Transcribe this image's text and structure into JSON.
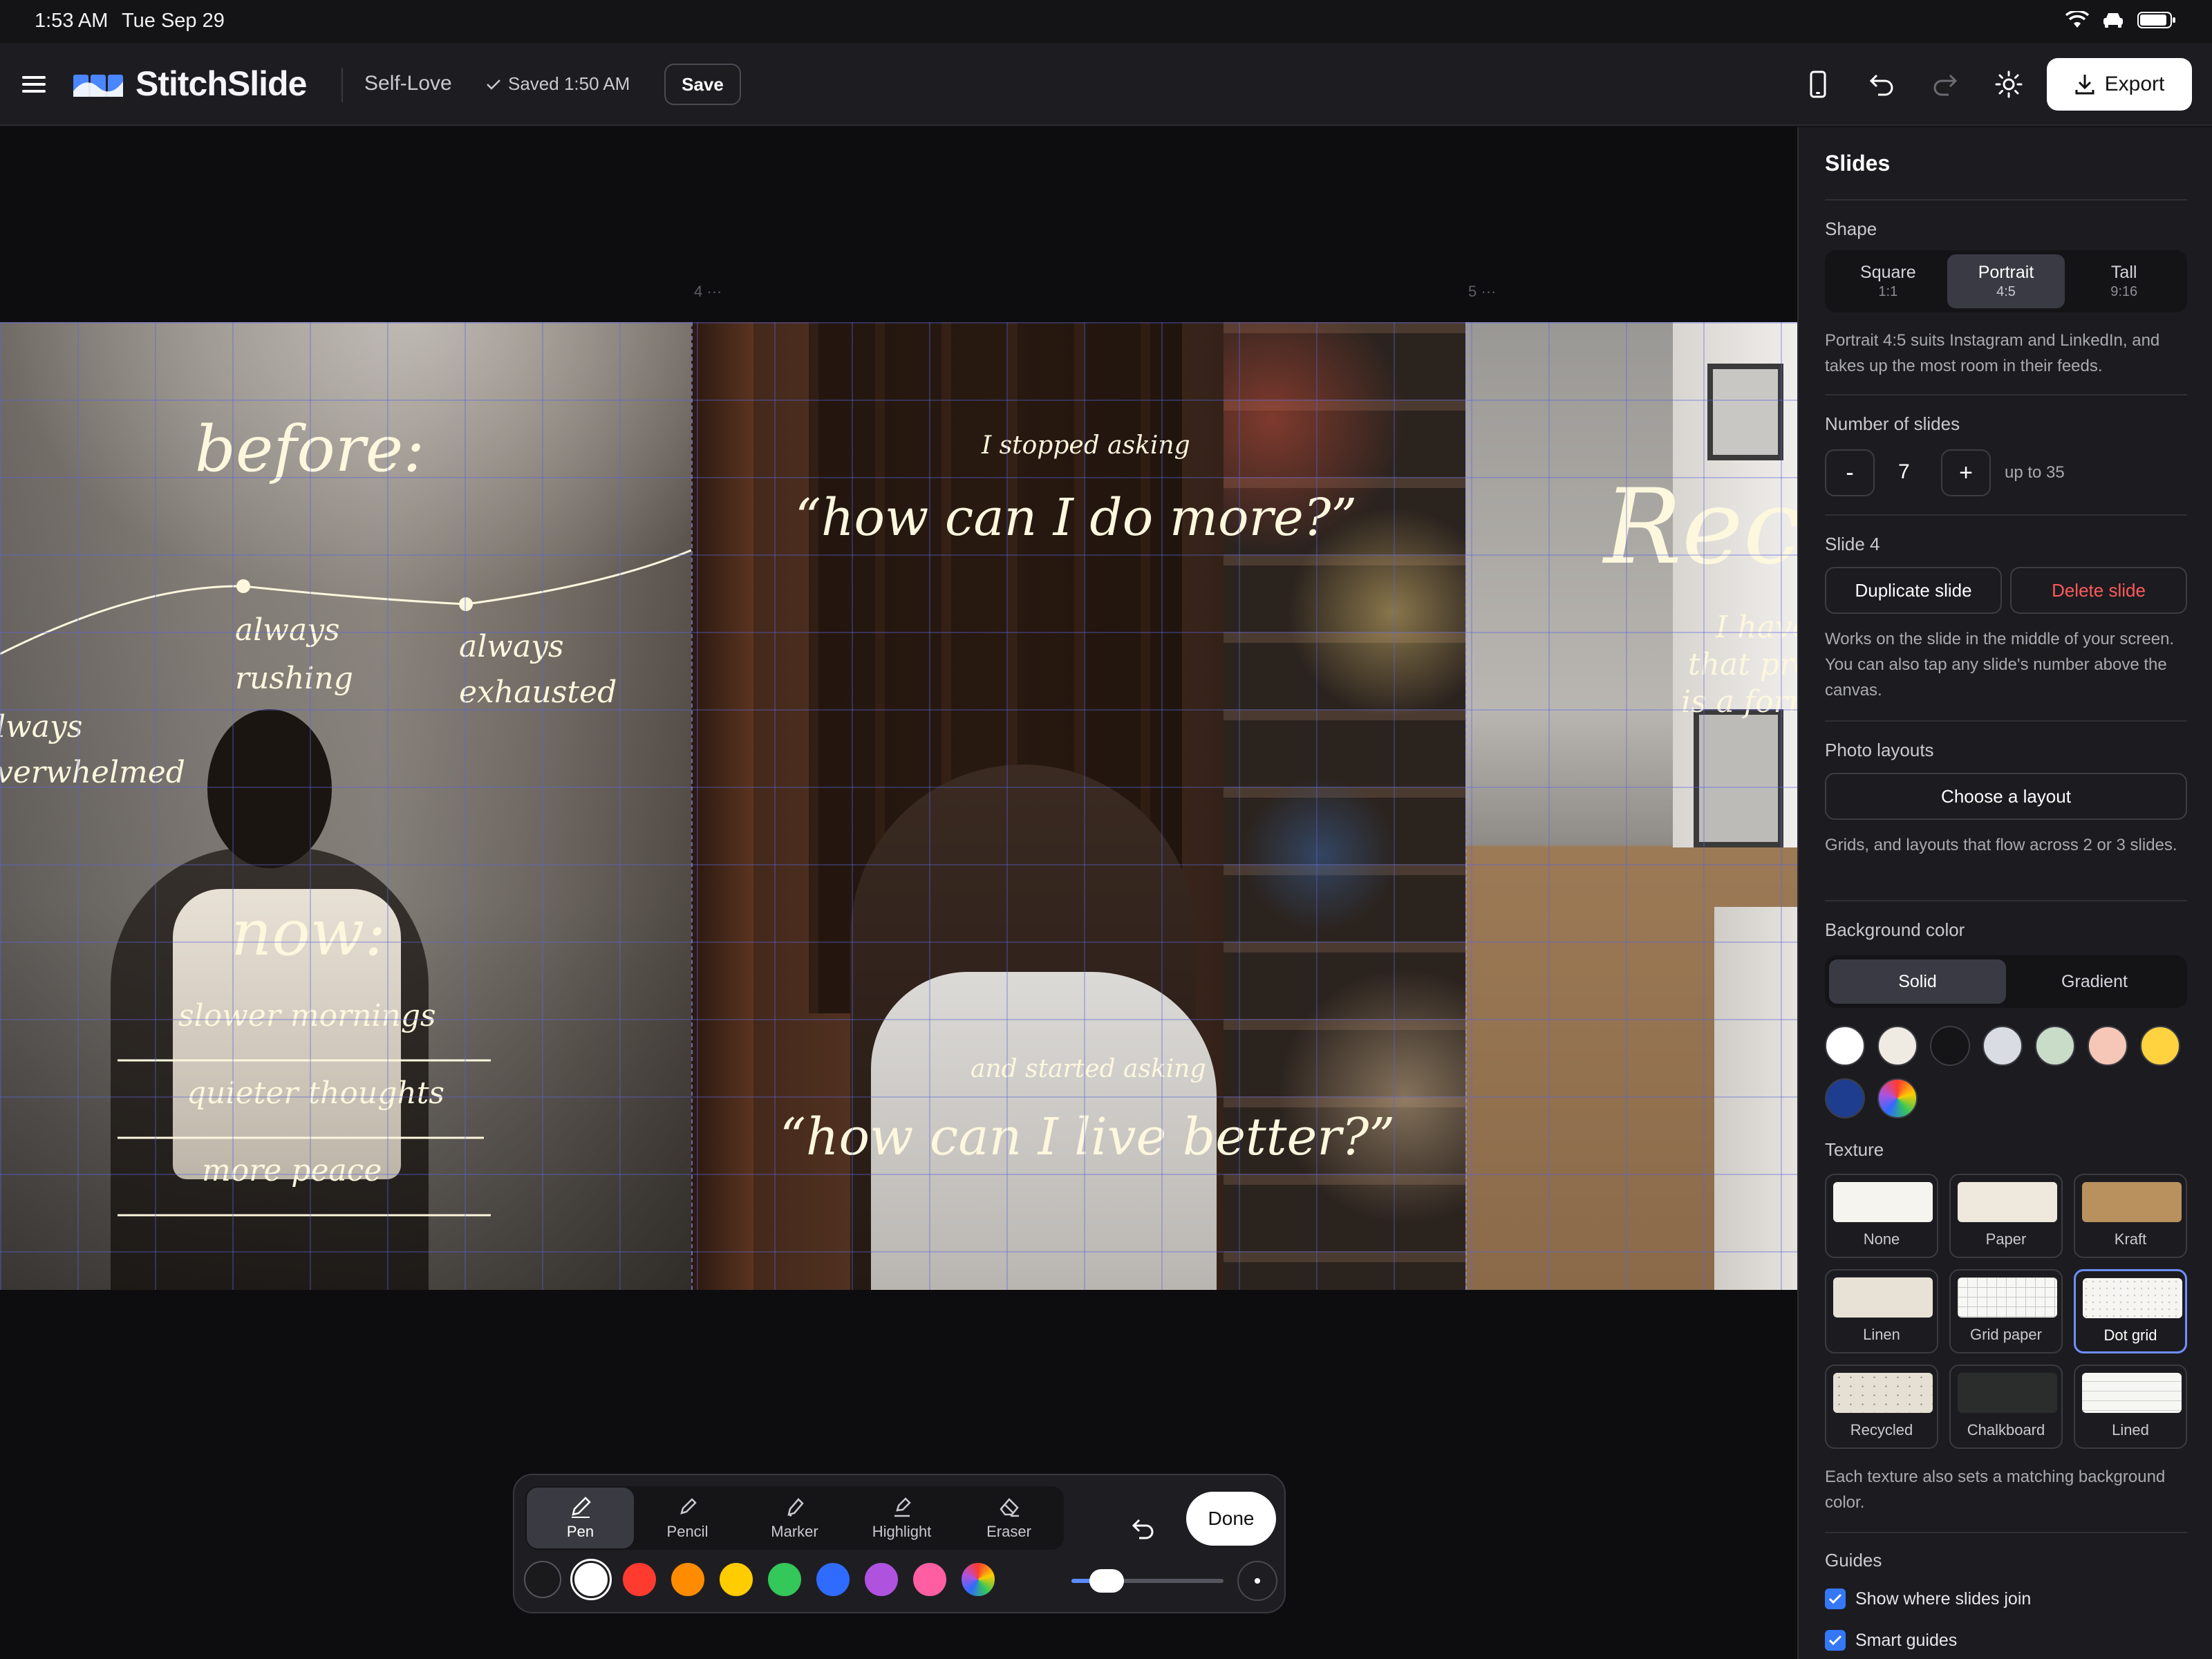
{
  "status": {
    "time": "1:53 AM",
    "date": "Tue Sep 29"
  },
  "app": {
    "name": "StitchSlide",
    "doc_title": "Self-Love",
    "saved": "Saved 1:50 AM",
    "save_label": "Save",
    "export_label": "Export"
  },
  "canvas": {
    "slide_numbers": [
      "4",
      "5"
    ],
    "slide_a": {
      "before": "before:",
      "always_rushing_1": "always",
      "always_rushing_2": "rushing",
      "always_exhausted_1": "always",
      "always_exhausted_2": "exhausted",
      "overwhelmed_1": "lways",
      "overwhelmed_2": "verwhelmed",
      "now": "now:",
      "line1": "slower mornings",
      "line2": "quieter thoughts",
      "line3": "more peace"
    },
    "slide_b": {
      "stopped": "I stopped asking",
      "quote1": "“how can I do more?”",
      "started": "and started asking",
      "quote2": "“how can I live better?”"
    },
    "slide_c": {
      "title": "Rec",
      "l1": "I have",
      "l2": "that pro",
      "l3": "is a form"
    }
  },
  "draw_toolbar": {
    "tools": [
      {
        "label": "Pen",
        "icon": "pen-icon"
      },
      {
        "label": "Pencil",
        "icon": "pencil-icon"
      },
      {
        "label": "Marker",
        "icon": "marker-icon"
      },
      {
        "label": "Highlight",
        "icon": "highlight-icon"
      },
      {
        "label": "Eraser",
        "icon": "eraser-icon"
      }
    ],
    "active_tool": "Pen",
    "done_label": "Done",
    "colors": [
      "#1a1a1d",
      "#ffffff",
      "#ff3b30",
      "#ff8c00",
      "#ffcc00",
      "#34c759",
      "#2f6bff",
      "#af52de",
      "#ff5fa2"
    ],
    "selected_color": "#ffffff",
    "stroke_size": 0.15
  },
  "panel": {
    "title": "Slides",
    "shape_label": "Shape",
    "shapes": [
      {
        "name": "Square",
        "ratio": "1:1"
      },
      {
        "name": "Portrait",
        "ratio": "4:5"
      },
      {
        "name": "Tall",
        "ratio": "9:16"
      }
    ],
    "shape_selected": "Portrait",
    "shape_help": "Portrait 4:5 suits Instagram and LinkedIn, and takes up the most room in their feeds.",
    "count_label": "Number of slides",
    "count_minus": "-",
    "count_value": "7",
    "count_plus": "+",
    "count_limit": "up to 35",
    "slide_label": "Slide 4",
    "duplicate_label": "Duplicate slide",
    "delete_label": "Delete slide",
    "slide_help": "Works on the slide in the middle of your screen. You can also tap any slide's number above the canvas.",
    "layouts_label": "Photo layouts",
    "layout_button": "Choose a layout",
    "layouts_help": "Grids, and layouts that flow across 2 or 3 slides.",
    "bg_label": "Background color",
    "bg_modes": [
      "Solid",
      "Gradient"
    ],
    "bg_mode_selected": "Solid",
    "bg_colors": [
      "#ffffff",
      "#efebe2",
      "#151518",
      "#d9dde3",
      "#c9dcc8",
      "#f6c7b6",
      "#ffd23f",
      "#1f3d8f"
    ],
    "texture_label": "Texture",
    "textures": [
      {
        "label": "None",
        "swatch": "#f6f4ef"
      },
      {
        "label": "Paper",
        "swatch": "#efe8dc"
      },
      {
        "label": "Kraft",
        "swatch": "#b8915f"
      },
      {
        "label": "Linen",
        "swatch": "#e8e2d6"
      },
      {
        "label": "Grid paper",
        "swatch": "#f7f7f5"
      },
      {
        "label": "Dot grid",
        "swatch": "#f6f5f2"
      },
      {
        "label": "Recycled",
        "swatch": "#e6e0d4"
      },
      {
        "label": "Chalkboard",
        "swatch": "#2a2d2b"
      },
      {
        "label": "Lined",
        "swatch": "#f6f6f3"
      }
    ],
    "texture_selected": "Dot grid",
    "texture_help": "Each texture also sets a matching background color.",
    "guides_label": "Guides",
    "guide1": "Show where slides join",
    "guide2": "Smart guides"
  }
}
